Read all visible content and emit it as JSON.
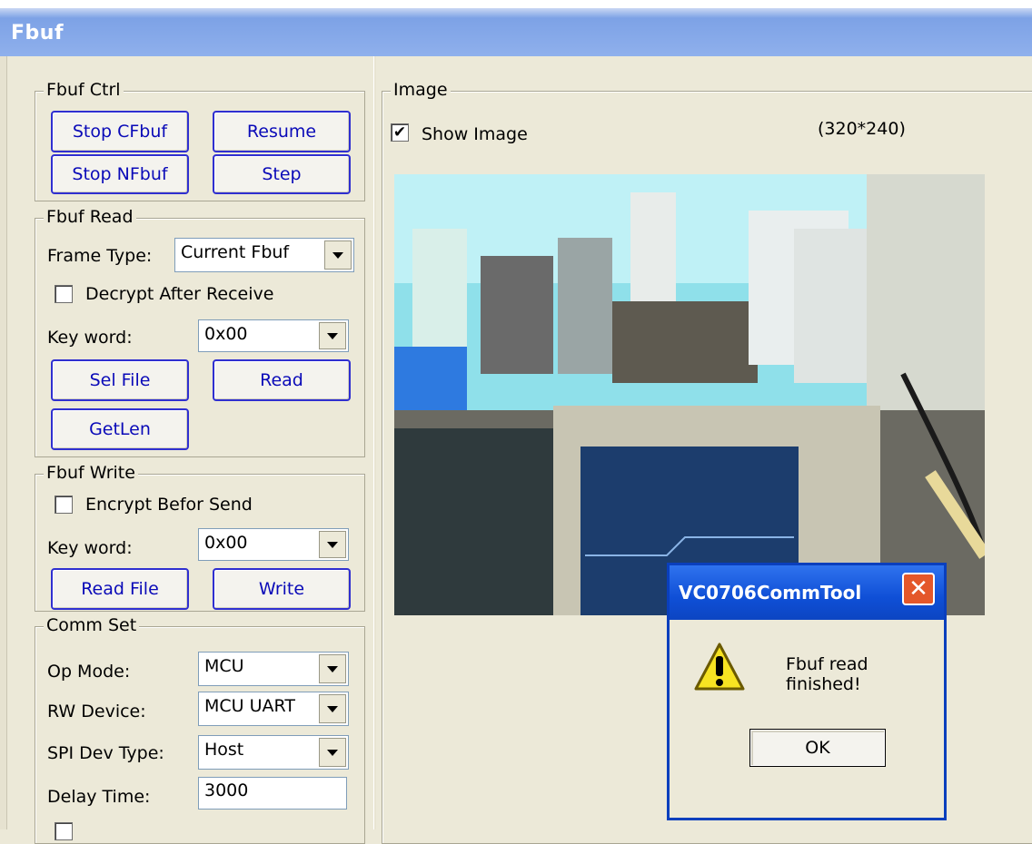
{
  "window": {
    "title": "Fbuf"
  },
  "fbuf_ctrl": {
    "legend": "Fbuf Ctrl",
    "stop_cfbuf": "Stop CFbuf",
    "resume": "Resume",
    "stop_nfbuf": "Stop NFbuf",
    "step": "Step"
  },
  "fbuf_read": {
    "legend": "Fbuf Read",
    "frame_type_label": "Frame Type:",
    "frame_type_value": "Current Fbuf",
    "decrypt_label": "Decrypt After Receive",
    "decrypt_checked": false,
    "keyword_label": "Key word:",
    "keyword_value": "0x00",
    "sel_file": "Sel File",
    "read": "Read",
    "getlen": "GetLen"
  },
  "fbuf_write": {
    "legend": "Fbuf Write",
    "encrypt_label": "Encrypt Befor Send",
    "encrypt_checked": false,
    "keyword_label": "Key word:",
    "keyword_value": "0x00",
    "read_file": "Read File",
    "write": "Write"
  },
  "comm_set": {
    "legend": "Comm Set",
    "op_mode_label": "Op Mode:",
    "op_mode_value": "MCU",
    "rw_device_label": "RW Device:",
    "rw_device_value": "MCU UART",
    "spi_type_label": "SPI Dev Type:",
    "spi_type_value": "Host",
    "delay_label": "Delay Time:",
    "delay_value": "3000"
  },
  "image": {
    "legend": "Image",
    "show_image_label": "Show Image",
    "show_image_checked": true,
    "resolution": "(320*240)"
  },
  "dialog": {
    "title": "VC0706CommTool",
    "message": "Fbuf read finished!",
    "ok": "OK",
    "close_glyph": "✕",
    "icon": "warning-icon"
  },
  "colors": {
    "titlebar": "#7da2e6",
    "dialog_titlebar": "#0f4fd6",
    "button_text": "#0a0ab8",
    "face": "#ece9d8"
  }
}
